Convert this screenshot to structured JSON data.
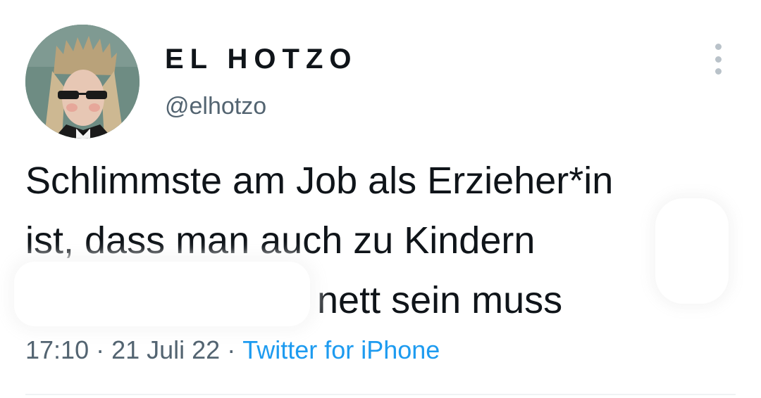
{
  "author": {
    "display_name": "EL HOTZO",
    "handle": "@elhotzo",
    "avatar_icon": "profile-photo"
  },
  "tweet": {
    "lines": [
      "Schlimmste am Job als Erzieher*in",
      "ist, dass man auch zu Kindern",
      "nett sein muss"
    ]
  },
  "meta": {
    "time": "17:10",
    "separator": "·",
    "date": "21 Juli 22",
    "source": "Twitter for iPhone"
  },
  "colors": {
    "text": "#0f1419",
    "secondary": "#536471",
    "link": "#1d9bf0",
    "more_dots": "#b9c2c9"
  },
  "icons": {
    "more": "more-options-icon"
  }
}
